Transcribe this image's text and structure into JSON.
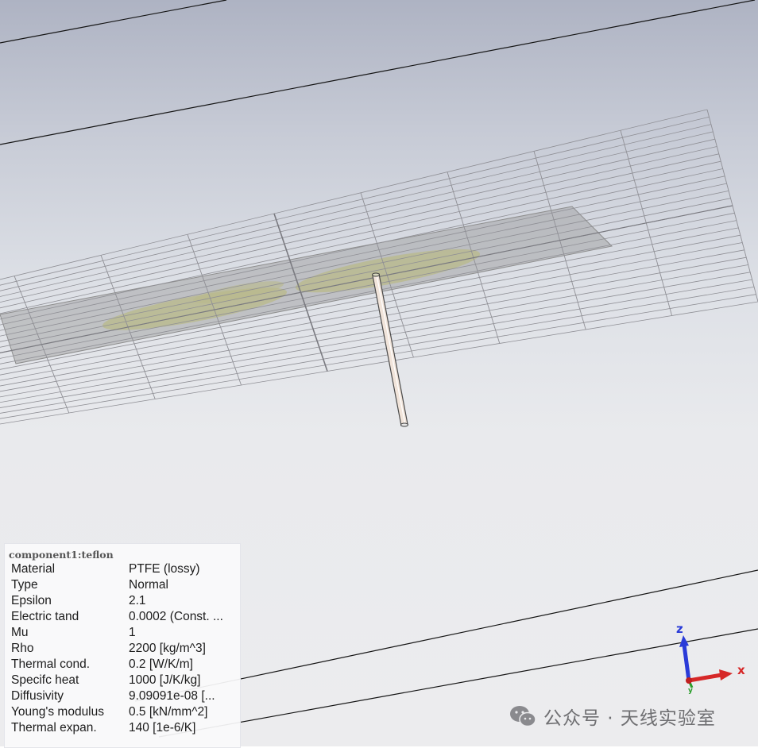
{
  "panel": {
    "title": "component1:teflon",
    "rows": [
      {
        "key": "Material",
        "value": "PTFE (lossy)"
      },
      {
        "key": "Type",
        "value": "Normal"
      },
      {
        "key": "Epsilon",
        "value": "2.1"
      },
      {
        "key": "Electric tand",
        "value": "0.0002 (Const. ..."
      },
      {
        "key": "Mu",
        "value": "1"
      },
      {
        "key": "Rho",
        "value": "2200 [kg/m^3]"
      },
      {
        "key": "Thermal cond.",
        "value": "0.2 [W/K/m]"
      },
      {
        "key": "Specifc heat",
        "value": "1000 [J/K/kg]"
      },
      {
        "key": "Diffusivity",
        "value": "9.09091e-08 [..."
      },
      {
        "key": "Young's modulus",
        "value": "0.5 [kN/mm^2]"
      },
      {
        "key": "Thermal expan.",
        "value": "140 [1e-6/K]"
      }
    ]
  },
  "axes": {
    "z_label": "z",
    "x_label": "x",
    "y_label": "y"
  },
  "watermark": {
    "text": "公众号 · 天线实验室",
    "icon": "wechat-icon"
  },
  "colors": {
    "x_axis": "#d62828",
    "z_axis": "#2a3bd8",
    "y_axis": "#2a9d2a",
    "patch": "#b9b98a"
  }
}
